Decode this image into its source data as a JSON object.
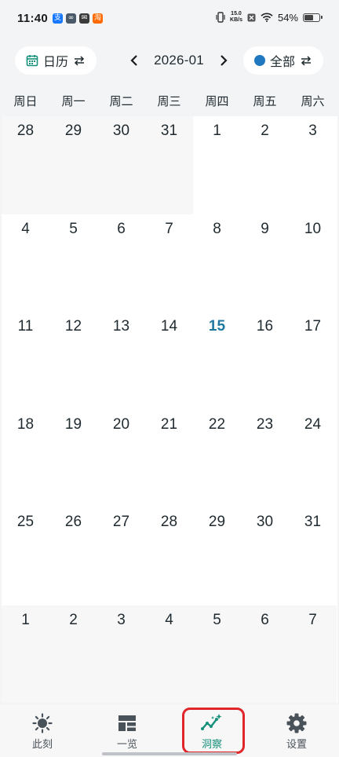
{
  "status_bar": {
    "time": "11:40",
    "app_icons": [
      {
        "name": "alipay-icon",
        "glyph": "支",
        "color": "#1677ff"
      },
      {
        "name": "link-app-icon",
        "glyph": "∞",
        "color": "#4a5a6a"
      },
      {
        "name": "mail-app-icon",
        "glyph": "✉",
        "color": "#3b3b3b"
      },
      {
        "name": "taobao-app-icon",
        "glyph": "淘",
        "color": "#ff6a00"
      }
    ],
    "net_speed_value": "15.0",
    "net_speed_unit": "KB/s",
    "battery_percent": "54%"
  },
  "header": {
    "view_label": "日历",
    "month_label": "2026-01",
    "filter_label": "全部",
    "filter_dot_color": "#1f78c0",
    "accent_color": "#15907a"
  },
  "weekdays": [
    "周日",
    "周一",
    "周二",
    "周三",
    "周四",
    "周五",
    "周六"
  ],
  "calendar": {
    "today": "15",
    "days": [
      {
        "label": "28",
        "other": true
      },
      {
        "label": "29",
        "other": true
      },
      {
        "label": "30",
        "other": true
      },
      {
        "label": "31",
        "other": true
      },
      {
        "label": "1"
      },
      {
        "label": "2"
      },
      {
        "label": "3"
      },
      {
        "label": "4"
      },
      {
        "label": "5"
      },
      {
        "label": "6"
      },
      {
        "label": "7"
      },
      {
        "label": "8"
      },
      {
        "label": "9"
      },
      {
        "label": "10"
      },
      {
        "label": "11"
      },
      {
        "label": "12"
      },
      {
        "label": "13"
      },
      {
        "label": "14"
      },
      {
        "label": "15",
        "today": true
      },
      {
        "label": "16"
      },
      {
        "label": "17"
      },
      {
        "label": "18"
      },
      {
        "label": "19"
      },
      {
        "label": "20"
      },
      {
        "label": "21"
      },
      {
        "label": "22"
      },
      {
        "label": "23"
      },
      {
        "label": "24"
      },
      {
        "label": "25"
      },
      {
        "label": "26"
      },
      {
        "label": "27"
      },
      {
        "label": "28"
      },
      {
        "label": "29"
      },
      {
        "label": "30"
      },
      {
        "label": "31"
      },
      {
        "label": "1",
        "other": true
      },
      {
        "label": "2",
        "other": true
      },
      {
        "label": "3",
        "other": true
      },
      {
        "label": "4",
        "other": true
      },
      {
        "label": "5",
        "other": true
      },
      {
        "label": "6",
        "other": true
      },
      {
        "label": "7",
        "other": true
      }
    ]
  },
  "bottom_nav": {
    "tabs": [
      {
        "label": "此刻",
        "icon": "sun-icon",
        "active": false
      },
      {
        "label": "一览",
        "icon": "dashboard-icon",
        "active": false
      },
      {
        "label": "洞察",
        "icon": "insights-icon",
        "active": true
      },
      {
        "label": "设置",
        "icon": "gear-icon",
        "active": false
      }
    ]
  }
}
